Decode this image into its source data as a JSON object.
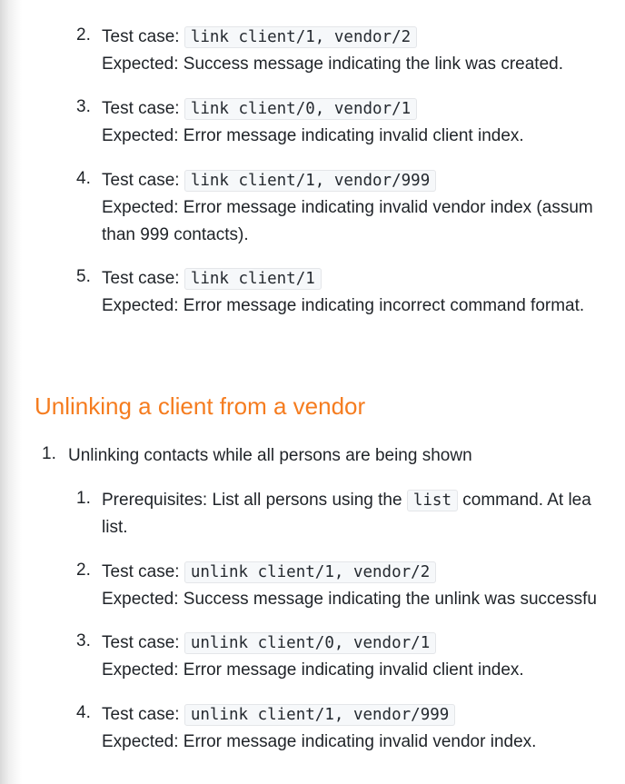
{
  "linking_list": [
    {
      "number": "2.",
      "label": "Test case:",
      "code": "link client/1, vendor/2",
      "expected": "Expected: Success message indicating the link was created."
    },
    {
      "number": "3.",
      "label": "Test case:",
      "code": "link client/0, vendor/1",
      "expected": "Expected: Error message indicating invalid client index."
    },
    {
      "number": "4.",
      "label": "Test case:",
      "code": "link client/1, vendor/999",
      "expected": "Expected: Error message indicating invalid vendor index (assum",
      "expected_cont": "than 999 contacts)."
    },
    {
      "number": "5.",
      "label": "Test case:",
      "code": "link client/1",
      "expected": "Expected: Error message indicating incorrect command format."
    }
  ],
  "unlink_section": {
    "heading": "Unlinking a client from a vendor",
    "outer_number": "1.",
    "outer_text": "Unlinking contacts while all persons are being shown",
    "prereq": {
      "number": "1.",
      "text_before": "Prerequisites: List all persons using the",
      "code": "list",
      "text_after": "command. At lea",
      "text_cont": "list."
    },
    "items": [
      {
        "number": "2.",
        "label": "Test case:",
        "code": "unlink client/1, vendor/2",
        "expected": "Expected: Success message indicating the unlink was successfu"
      },
      {
        "number": "3.",
        "label": "Test case:",
        "code": "unlink client/0, vendor/1",
        "expected": "Expected: Error message indicating invalid client index."
      },
      {
        "number": "4.",
        "label": "Test case:",
        "code": "unlink client/1, vendor/999",
        "expected": "Expected: Error message indicating invalid vendor index."
      }
    ]
  }
}
